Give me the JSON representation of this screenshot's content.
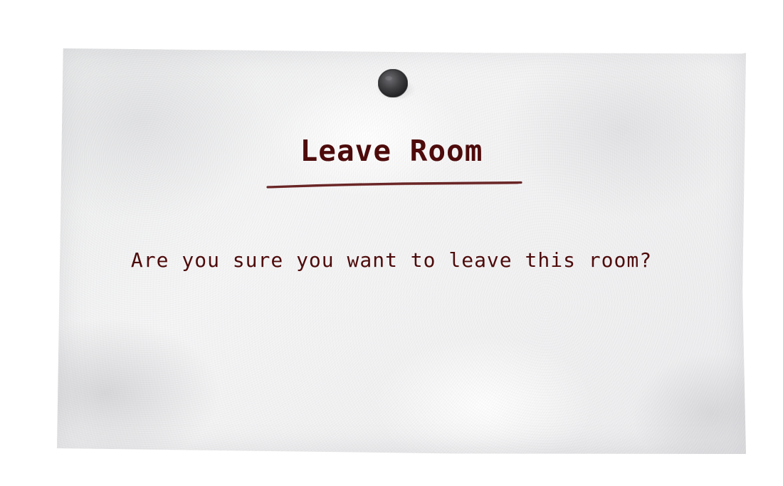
{
  "dialog": {
    "title": "Leave Room",
    "message": "Are you sure you want to leave this room?"
  },
  "icons": {
    "pin": "pushpin-icon"
  },
  "colors": {
    "text": "#4e0b0b",
    "underline": "#5a0f10",
    "pin": "#3f3f42",
    "paper": "#f2f2f3",
    "background": "#ffffff"
  }
}
